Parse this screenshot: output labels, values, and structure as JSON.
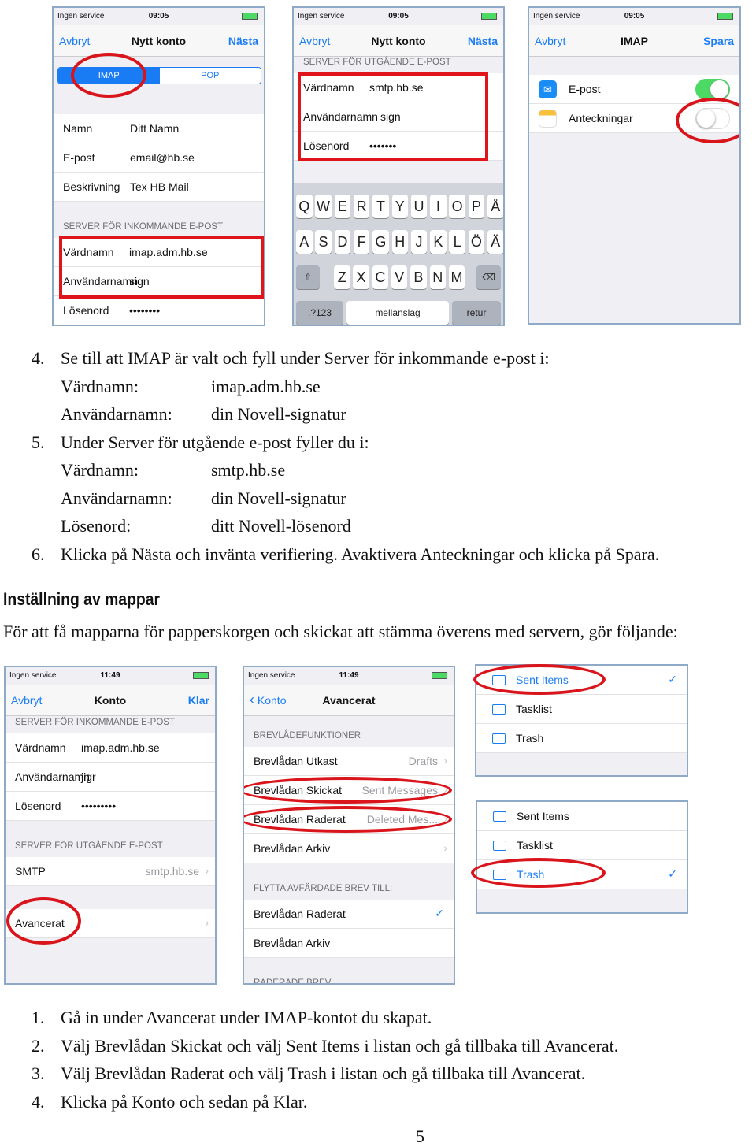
{
  "status": {
    "carrier": "Ingen service",
    "time1": "09:05",
    "time2": "11:49"
  },
  "p1": {
    "nav": {
      "left": "Avbryt",
      "title": "Nytt konto",
      "right": "Nästa"
    },
    "seg": [
      "IMAP",
      "POP"
    ],
    "rows": [
      {
        "k": "Namn",
        "v": "Ditt Namn"
      },
      {
        "k": "E-post",
        "v": "email@hb.se"
      },
      {
        "k": "Beskrivning",
        "v": "Tex HB Mail"
      }
    ],
    "header": "SERVER FÖR INKOMMANDE E-POST",
    "rows2": [
      {
        "k": "Värdnamn",
        "v": "imap.adm.hb.se"
      },
      {
        "k": "Användarnamn",
        "v": "sign"
      },
      {
        "k": "Lösenord",
        "v": "••••••••"
      }
    ]
  },
  "p2": {
    "nav": {
      "left": "Avbryt",
      "title": "Nytt konto",
      "right": "Nästa"
    },
    "header": "SERVER FÖR UTGÅENDE E-POST",
    "rows": [
      {
        "k": "Värdnamn",
        "v": "smtp.hb.se"
      },
      {
        "k": "Användarnamn",
        "v": "sign"
      },
      {
        "k": "Lösenord",
        "v": "•••••••"
      }
    ],
    "keys1": [
      "Q",
      "W",
      "E",
      "R",
      "T",
      "Y",
      "U",
      "I",
      "O",
      "P",
      "Å"
    ],
    "keys2": [
      "A",
      "S",
      "D",
      "F",
      "G",
      "H",
      "J",
      "K",
      "L",
      "Ö",
      "Ä"
    ],
    "keys3": [
      "Z",
      "X",
      "C",
      "V",
      "B",
      "N",
      "M"
    ],
    "num": ".?123",
    "space": "mellanslag",
    "ret": "retur"
  },
  "p3": {
    "nav": {
      "left": "Avbryt",
      "title": "IMAP",
      "right": "Spara"
    },
    "rows": [
      {
        "k": "E-post",
        "on": true
      },
      {
        "k": "Anteckningar",
        "on": false
      }
    ]
  },
  "p4": {
    "nav": {
      "left": "Avbryt",
      "title": "Konto",
      "right": "Klar"
    },
    "header1": "SERVER FÖR INKOMMANDE E-POST",
    "rows": [
      {
        "k": "Värdnamn",
        "v": "imap.adm.hb.se"
      },
      {
        "k": "Användarnamn",
        "v": "jigr"
      },
      {
        "k": "Lösenord",
        "v": "•••••••••"
      }
    ],
    "header2": "SERVER FÖR UTGÅENDE E-POST",
    "smtp": {
      "k": "SMTP",
      "v": "smtp.hb.se"
    },
    "adv": "Avancerat"
  },
  "p5": {
    "nav": {
      "back": "Konto",
      "title": "Avancerat"
    },
    "header1": "BREVLÅDEFUNKTIONER",
    "rows": [
      {
        "k": "Brevlådan Utkast",
        "v": "Drafts"
      },
      {
        "k": "Brevlådan Skickat",
        "v": "Sent Messages"
      },
      {
        "k": "Brevlådan Raderat",
        "v": "Deleted Mes..."
      },
      {
        "k": "Brevlådan Arkiv",
        "v": ""
      }
    ],
    "header2": "FLYTTA AVFÄRDADE BREV TILL:",
    "rows2": [
      "Brevlådan Raderat",
      "Brevlådan Arkiv"
    ],
    "header3": "RADERADE BREV"
  },
  "p6": {
    "items": [
      "Sent Items",
      "Tasklist",
      "Trash"
    ],
    "selected": 0
  },
  "p7": {
    "items": [
      "Sent Items",
      "Tasklist",
      "Trash"
    ],
    "selected": 2
  },
  "doc": {
    "list1": [
      {
        "n": "4.",
        "t": "Se till att IMAP är valt och fyll under Server för inkommande e-post i:"
      },
      {
        "k": "Värdnamn:",
        "v": "imap.adm.hb.se"
      },
      {
        "k": "Användarnamn:",
        "v": "din Novell-signatur"
      },
      {
        "n": "5.",
        "t": "Under Server för utgående e-post fyller du i:"
      },
      {
        "k": "Värdnamn:",
        "v": "smtp.hb.se"
      },
      {
        "k": "Användarnamn:",
        "v": "din Novell-signatur"
      },
      {
        "k": "Lösenord:",
        "v": "ditt Novell-lösenord"
      },
      {
        "n": "6.",
        "t": "Klicka på Nästa och invänta verifiering. Avaktivera Anteckningar och klicka på Spara."
      }
    ],
    "heading": "Inställning av mappar",
    "para": "För att få mapparna för papperskorgen och skickat att stämma överens med servern, gör följande:",
    "list2": [
      {
        "n": "1.",
        "t": "Gå in under Avancerat under IMAP-kontot du skapat."
      },
      {
        "n": "2.",
        "t": "Välj Brevlådan Skickat och välj Sent Items i listan och gå tillbaka till Avancerat."
      },
      {
        "n": "3.",
        "t": "Välj Brevlådan Raderat och välj Trash i listan och gå tillbaka till Avancerat."
      },
      {
        "n": "4.",
        "t": "Klicka på Konto och sedan på Klar."
      }
    ],
    "page": "5"
  },
  "colors": {
    "ios_blue": "#1a7cf5",
    "highlight_red": "#e0141b",
    "toggle_green": "#4cd964"
  }
}
